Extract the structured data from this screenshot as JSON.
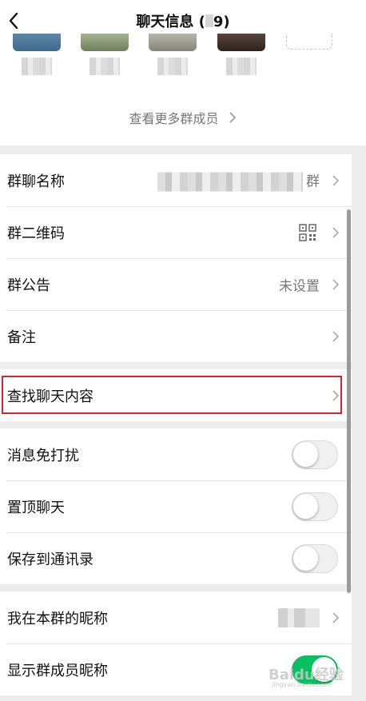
{
  "nav": {
    "title": "聊天信息 (",
    "title_count": "9)"
  },
  "members": {
    "items": [
      {
        "avatar_color": "#3e6a8f"
      },
      {
        "avatar_color": "#7d8f6a"
      },
      {
        "avatar_color": "#8a8a80"
      },
      {
        "avatar_color": "#3a2a26"
      }
    ],
    "more_label": "查看更多群成员"
  },
  "group1": {
    "group_name_label": "群聊名称",
    "group_name_suffix": "群",
    "qr_label": "群二维码",
    "notice_label": "群公告",
    "notice_value": "未设置",
    "remark_label": "备注"
  },
  "group2": {
    "search_label": "查找聊天内容"
  },
  "group3": {
    "mute_label": "消息免打扰",
    "mute_on": false,
    "pin_label": "置顶聊天",
    "pin_on": false,
    "save_label": "保存到通讯录",
    "save_on": false
  },
  "group4": {
    "my_nick_label": "我在本群的昵称",
    "show_nick_label": "显示群成员昵称",
    "show_nick_on": true
  },
  "watermark": {
    "logo_text": "Baidu经验",
    "url_text": "jingyan.baidu.com"
  },
  "colors": {
    "accent_green": "#07c160",
    "highlight_red": "#d9232d"
  }
}
